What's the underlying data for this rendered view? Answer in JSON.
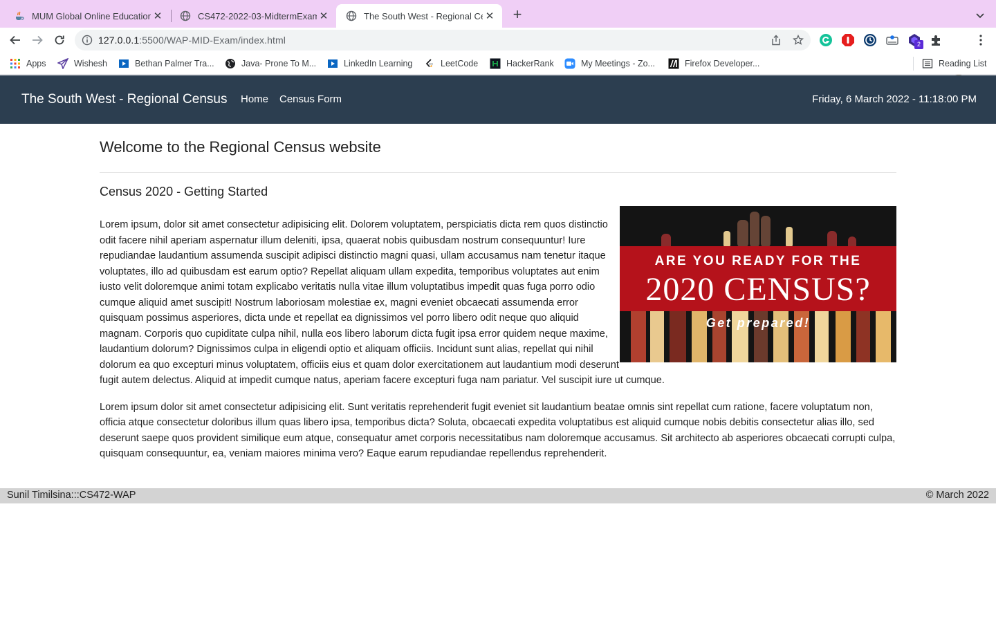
{
  "browser": {
    "tabs": [
      {
        "title": "MUM Global Online Education ..."
      },
      {
        "title": "CS472-2022-03-MidtermExam"
      },
      {
        "title": "The South West - Regional Cer"
      }
    ],
    "url_host": "127.0.0.1",
    "url_path": ":5500/WAP-MID-Exam/index.html",
    "extension_badge": "2",
    "bookmarks": [
      {
        "label": "Apps",
        "icon": "apps-grid-icon"
      },
      {
        "label": "Wishesh",
        "icon": "paper-plane-icon"
      },
      {
        "label": "Bethan Palmer Tra...",
        "icon": "video-icon"
      },
      {
        "label": "Java- Prone To M...",
        "icon": "globe-icon"
      },
      {
        "label": "LinkedIn Learning",
        "icon": "video-icon"
      },
      {
        "label": "LeetCode",
        "icon": "leetcode-icon"
      },
      {
        "label": "HackerRank",
        "icon": "hackerrank-icon"
      },
      {
        "label": "My Meetings - Zo...",
        "icon": "zoom-icon"
      },
      {
        "label": "Firefox Developer...",
        "icon": "mdn-icon"
      }
    ],
    "reading_list": "Reading List",
    "colors": {
      "tabstrip": "#f0cff6"
    }
  },
  "site": {
    "brand": "The South West - Regional Census",
    "nav": [
      "Home",
      "Census Form"
    ],
    "datetime": "Friday, 6 March 2022 - 11:18:00 PM",
    "colors": {
      "header": "#2c3e50"
    }
  },
  "main": {
    "welcome": "Welcome to the Regional Census website",
    "subheading": "Census 2020 - Getting Started",
    "banner": {
      "line1": "ARE YOU READY FOR THE",
      "line2": "2020 CENSUS?",
      "line3": "Get prepared!"
    },
    "paragraphs": [
      "Lorem ipsum, dolor sit amet consectetur adipisicing elit. Dolorem voluptatem, perspiciatis dicta rem quos distinctio odit facere nihil aperiam aspernatur illum deleniti, ipsa, quaerat nobis quibusdam nostrum consequuntur! Iure repudiandae laudantium assumenda suscipit adipisci distinctio magni quasi, ullam accusamus nam tenetur itaque voluptates, illo ad quibusdam est earum optio? Repellat aliquam ullam expedita, temporibus voluptates aut enim iusto velit doloremque animi totam explicabo veritatis nulla vitae illum voluptatibus impedit quas fuga porro odio cumque aliquid amet suscipit! Nostrum laboriosam molestiae ex, magni eveniet obcaecati assumenda error quisquam possimus asperiores, dicta unde et repellat ea dignissimos vel porro libero odit neque quo aliquid magnam. Corporis quo cupiditate culpa nihil, nulla eos libero laborum dicta fugit ipsa error quidem neque maxime, laudantium dolorum? Dignissimos culpa in eligendi optio et aliquam officiis. Incidunt sunt alias, repellat qui nihil dolorum ea quo excepturi minus voluptatem, officiis eius et quam dolor exercitationem aut laudantium modi deserunt fugit autem delectus. Aliquid at impedit cumque natus, aperiam facere excepturi fuga nam pariatur. Vel suscipit iure ut cumque.",
      "Lorem ipsum dolor sit amet consectetur adipisicing elit. Sunt veritatis reprehenderit fugit eveniet sit laudantium beatae omnis sint repellat cum ratione, facere voluptatum non, officia atque consectetur doloribus illum quas libero ipsa, temporibus dicta? Soluta, obcaecati expedita voluptatibus est aliquid cumque nobis debitis consectetur alias illo, sed deserunt saepe quos provident similique eum atque, consequatur amet corporis necessitatibus nam doloremque accusamus. Sit architecto ab asperiores obcaecati corrupti culpa, quisquam consequuntur, ea, veniam maiores minima vero? Eaque earum repudiandae repellendus reprehenderit."
    ]
  },
  "footer": {
    "left": "Sunil Timilsina:::CS472-WAP",
    "right": "© March 2022"
  }
}
